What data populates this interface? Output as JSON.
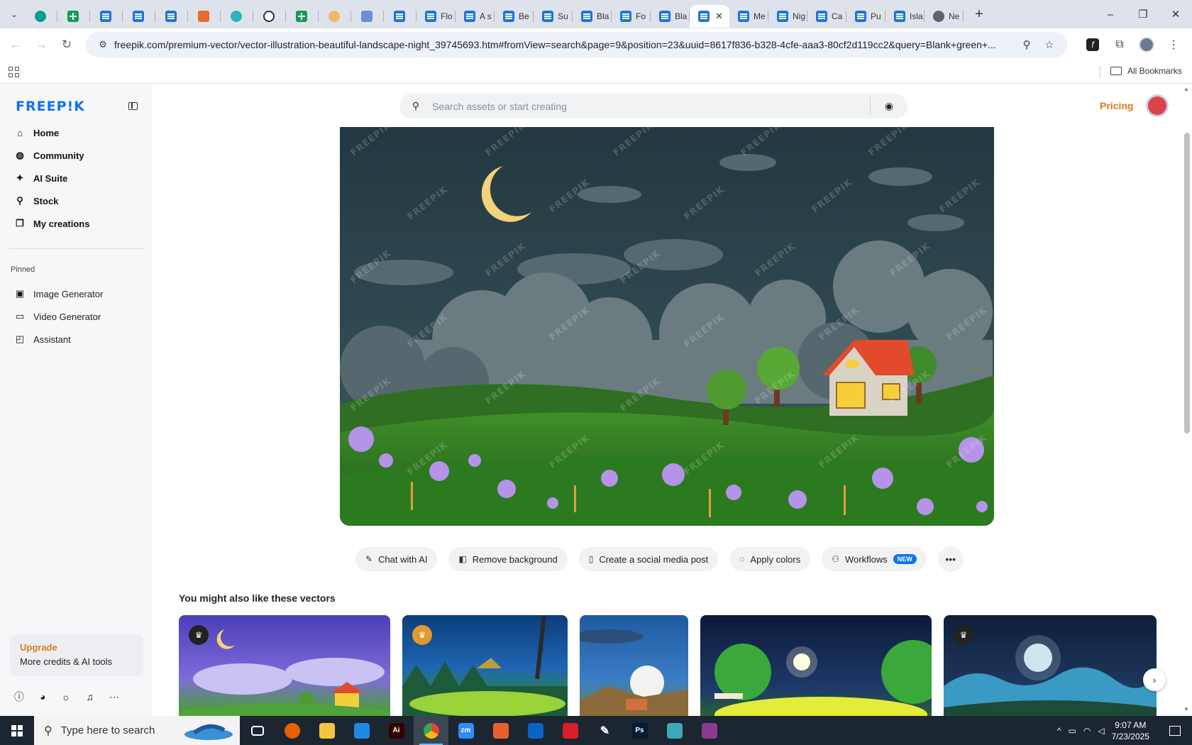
{
  "browser": {
    "tabs": [
      {
        "label": "",
        "icon": "wordpress-icon",
        "pinned": true
      },
      {
        "label": "",
        "icon": "google-sheets-icon",
        "pinned": true
      },
      {
        "label": "",
        "icon": "google-docs-icon",
        "pinned": true
      },
      {
        "label": "",
        "icon": "google-docs-icon",
        "pinned": true
      },
      {
        "label": "",
        "icon": "google-docs-icon",
        "pinned": true
      },
      {
        "label": "",
        "icon": "orange-app-icon",
        "pinned": true
      },
      {
        "label": "",
        "icon": "teal-app-icon",
        "pinned": true
      },
      {
        "label": "",
        "icon": "openai-icon",
        "pinned": true
      },
      {
        "label": "",
        "icon": "google-sheets-icon",
        "pinned": true
      },
      {
        "label": "",
        "icon": "hand-icon",
        "pinned": true
      },
      {
        "label": "",
        "icon": "grid-app-icon",
        "pinned": true
      },
      {
        "label": "",
        "icon": "google-docs-icon",
        "pinned": true
      },
      {
        "label": "Flo",
        "icon": "google-docs-icon",
        "pinned": false
      },
      {
        "label": "A s",
        "icon": "google-docs-icon",
        "pinned": false
      },
      {
        "label": "Be",
        "icon": "google-docs-icon",
        "pinned": false
      },
      {
        "label": "Su",
        "icon": "google-docs-icon",
        "pinned": false
      },
      {
        "label": "Bla",
        "icon": "google-docs-icon",
        "pinned": false
      },
      {
        "label": "Fo",
        "icon": "google-docs-icon",
        "pinned": false
      },
      {
        "label": "Bla",
        "icon": "google-docs-icon",
        "pinned": false
      },
      {
        "label": "",
        "icon": "google-docs-icon",
        "pinned": false,
        "active": true
      },
      {
        "label": "Me",
        "icon": "google-docs-icon",
        "pinned": false
      },
      {
        "label": "Nig",
        "icon": "google-docs-icon",
        "pinned": false
      },
      {
        "label": "Ca",
        "icon": "google-docs-icon",
        "pinned": false
      },
      {
        "label": "Pu",
        "icon": "google-docs-icon",
        "pinned": false
      },
      {
        "label": "Isla",
        "icon": "google-docs-icon",
        "pinned": false
      },
      {
        "label": "Ne",
        "icon": "globe-icon",
        "pinned": false
      }
    ],
    "url": "freepik.com/premium-vector/vector-illustration-beautiful-landscape-night_39745693.htm#fromView=search&page=9&position=23&uuid=8617f836-b328-4cfe-aaa3-80cf2d119cc2&query=Blank+green+...",
    "all_bookmarks_label": "All Bookmarks",
    "window_controls": {
      "minimize": "–",
      "restore": "❐",
      "close": "✕"
    }
  },
  "sidebar": {
    "logo": "FREEP!K",
    "nav": [
      {
        "label": "Home",
        "icon": "⌂",
        "name": "home"
      },
      {
        "label": "Community",
        "icon": "◍",
        "name": "community"
      },
      {
        "label": "AI Suite",
        "icon": "✦",
        "name": "ai-suite"
      },
      {
        "label": "Stock",
        "icon": "⚲",
        "name": "stock"
      },
      {
        "label": "My creations",
        "icon": "❐",
        "name": "my-creations"
      }
    ],
    "pinned_label": "Pinned",
    "pinned": [
      {
        "label": "Image Generator",
        "icon": "▣",
        "name": "image-generator"
      },
      {
        "label": "Video Generator",
        "icon": "▭",
        "name": "video-generator"
      },
      {
        "label": "Assistant",
        "icon": "◰",
        "name": "assistant"
      }
    ],
    "upgrade": {
      "title": "Upgrade",
      "subtitle": "More credits & AI tools"
    }
  },
  "header": {
    "search_placeholder": "Search assets or start creating",
    "pricing_label": "Pricing"
  },
  "hero": {
    "watermark": "FREEPIK"
  },
  "actions": [
    {
      "label": "Chat with AI",
      "icon": "✎",
      "name": "chat-with-ai"
    },
    {
      "label": "Remove background",
      "icon": "◧",
      "name": "remove-background"
    },
    {
      "label": "Create a social media post",
      "icon": "▯",
      "name": "create-social-post"
    },
    {
      "label": "Apply colors",
      "icon": "◌",
      "name": "apply-colors"
    },
    {
      "label": "Workflows",
      "icon": "⚇",
      "name": "workflows",
      "badge": "NEW"
    }
  ],
  "related": {
    "title": "You might also like these vectors"
  },
  "taskbar": {
    "search_placeholder": "Type here to search",
    "time": "9:07 AM",
    "date": "7/23/2025",
    "apps": [
      {
        "name": "task-view",
        "label": "",
        "color": "transparent"
      },
      {
        "name": "firefox",
        "label": "",
        "color": "#e66000"
      },
      {
        "name": "file-explorer",
        "label": "",
        "color": "#f4c542"
      },
      {
        "name": "vscode",
        "label": "",
        "color": "#1e88e5"
      },
      {
        "name": "illustrator",
        "label": "Ai",
        "color": "#330000"
      },
      {
        "name": "chrome",
        "label": "",
        "color": "#34a853",
        "active": true
      },
      {
        "name": "zoom",
        "label": "zm",
        "color": "#2d8cff"
      },
      {
        "name": "orange-app",
        "label": "",
        "color": "#e8602c"
      },
      {
        "name": "outlook",
        "label": "",
        "color": "#0a64c4"
      },
      {
        "name": "creative-cloud",
        "label": "",
        "color": "#da1f26"
      },
      {
        "name": "pen-tool",
        "label": "",
        "color": "transparent"
      },
      {
        "name": "photoshop",
        "label": "Ps",
        "color": "#001e36"
      },
      {
        "name": "diamond-app",
        "label": "",
        "color": "#3ea7b8"
      },
      {
        "name": "winrar",
        "label": "",
        "color": "#8a3b8f"
      }
    ]
  }
}
